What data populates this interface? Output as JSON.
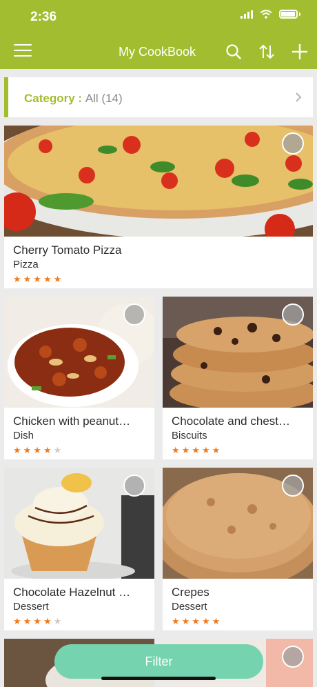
{
  "status_bar": {
    "time": "2:36"
  },
  "header": {
    "title": "My CookBook",
    "icons": [
      "menu-icon",
      "search-icon",
      "sort-icon",
      "add-icon"
    ]
  },
  "category": {
    "label": "Category :",
    "value": "All (14)"
  },
  "recipes": [
    {
      "title": "Cherry Tomato Pizza",
      "category": "Pizza",
      "rating": 5,
      "stars": "★★★★★",
      "stars_empty": ""
    },
    {
      "title": "Chicken with peanut…",
      "category": "Dish",
      "rating": 4,
      "stars": "★★★★",
      "stars_empty": "★"
    },
    {
      "title": "Chocolate and chest…",
      "category": "Biscuits",
      "rating": 5,
      "stars": "★★★★★",
      "stars_empty": ""
    },
    {
      "title": "Chocolate Hazelnut …",
      "category": "Dessert",
      "rating": 4,
      "stars": "★★★★",
      "stars_empty": "★"
    },
    {
      "title": "Crepes",
      "category": "Dessert",
      "rating": 5,
      "stars": "★★★★★",
      "stars_empty": ""
    }
  ],
  "filter_button": {
    "label": "Filter"
  },
  "colors": {
    "accent": "#a3bd31",
    "filter": "#76d3b0",
    "star": "#f07a1d",
    "background": "#ebebeb"
  }
}
